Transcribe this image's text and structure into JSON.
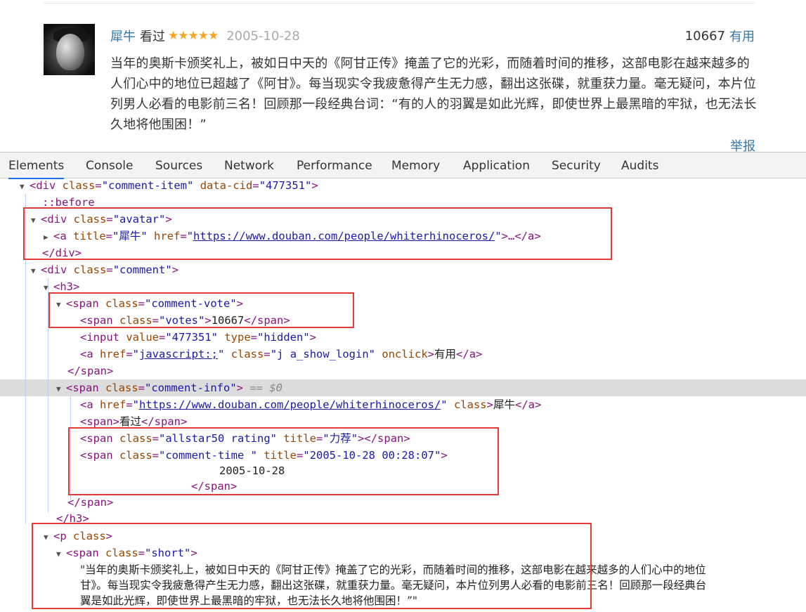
{
  "page": {
    "user": "犀牛",
    "watched": "看过",
    "stars": "★★★★★",
    "time": "2005-10-28",
    "votes": "10667",
    "useful": "有用",
    "short": "当年的奥斯卡颁奖礼上，被如日中天的《阿甘正传》掩盖了它的光彩，而随着时间的推移，这部电影在越来越多的人们心中的地位已超越了《阿甘》。每当现实令我疲惫得产生无力感，翻出这张碟，就重获力量。毫无疑问，本片位列男人必看的电影前三名！回顾那一段经典台词：“有的人的羽翼是如此光辉，即使世界上最黑暗的牢狱，也无法长久地将他围困！”",
    "report": "举报"
  },
  "devtools": {
    "tabs": [
      "Elements",
      "Console",
      "Sources",
      "Network",
      "Performance",
      "Memory",
      "Application",
      "Security",
      "Audits"
    ],
    "tree": {
      "l1_tag_open": "<div ",
      "l1_attr1": "class",
      "l1_val1": "\"comment-item\"",
      "l1_attr2": "data-cid",
      "l1_val2": "\"477351\"",
      "l1_tag_close": ">",
      "l2": "::before",
      "l3_tag_open": "<div ",
      "l3_attr": "class",
      "l3_val": "\"avatar\"",
      "l3_tag_close": ">",
      "l4_tag_open": "<a ",
      "l4_attr1": "title",
      "l4_val1": "\"犀牛\"",
      "l4_attr2": "href",
      "l4_q1": "\"",
      "l4_link": "https://www.douban.com/people/whiterhinoceros/",
      "l4_q2": "\"",
      "l4_tag_close": ">…</a>",
      "l5": "</div>",
      "l6_tag_open": "<div ",
      "l6_attr": "class",
      "l6_val": "\"comment\"",
      "l6_tag_close": ">",
      "l7": "<h3>",
      "l8_tag_open": "<span ",
      "l8_attr": "class",
      "l8_val": "\"comment-vote\"",
      "l8_tag_close": ">",
      "l9_tag_open": "<span ",
      "l9_attr": "class",
      "l9_val": "\"votes\"",
      "l9_gt": ">",
      "l9_text": "10667",
      "l9_close": "</span>",
      "l10_tag_open": "<input ",
      "l10_attr1": "value",
      "l10_val1": "\"477351\"",
      "l10_attr2": "type",
      "l10_val2": "\"hidden\"",
      "l10_tag_close": ">",
      "l11_tag_open": "<a ",
      "l11_attr1": "href",
      "l11_q1": "\"",
      "l11_link": "javascript:;",
      "l11_q2": "\"",
      "l11_attr2": "class",
      "l11_val2": "\"j a_show_login\"",
      "l11_attr3": "onclick",
      "l11_gt": ">",
      "l11_text": "有用",
      "l11_close": "</a>",
      "l12": "</span>",
      "l13_tag_open": "<span ",
      "l13_attr": "class",
      "l13_val": "\"comment-info\"",
      "l13_tag_close": ">",
      "l13_eq": " == $0",
      "l14_tag_open": "<a ",
      "l14_attr1": "href",
      "l14_q1": "\"",
      "l14_link": "https://www.douban.com/people/whiterhinoceros/",
      "l14_q2": "\"",
      "l14_attr2": "class",
      "l14_gt": ">",
      "l14_text": "犀牛",
      "l14_close": "</a>",
      "l15_open": "<span>",
      "l15_text": "看过",
      "l15_close": "</span>",
      "l16_tag_open": "<span ",
      "l16_attr1": "class",
      "l16_val1": "\"allstar50 rating\"",
      "l16_attr2": "title",
      "l16_val2": "\"力荐\"",
      "l16_tag_close": "></span>",
      "l17_tag_open": "<span ",
      "l17_attr1": "class",
      "l17_val1": "\"comment-time \"",
      "l17_attr2": "title",
      "l17_val2": "\"2005-10-28 00:28:07\"",
      "l17_tag_close": ">",
      "l18": "2005-10-28",
      "l19": "</span>",
      "l20": "</span>",
      "l21": "</h3>",
      "l22_tag_open": "<p ",
      "l22_attr": "class",
      "l22_tag_close": ">",
      "l23_tag_open": "<span ",
      "l23_attr": "class",
      "l23_val": "\"short\"",
      "l23_tag_close": ">",
      "l24": "\"当年的奥斯卡颁奖礼上，被如日中天的《阿甘正传》掩盖了它的光彩，而随着时间的推移，这部电影在越来越多的人们心中的地位",
      "l25": "甘》。每当现实令我疲惫得产生无力感，翻出这张碟，就重获力量。毫无疑问，本片位列男人必看的电影前三名！回顾那一段经典台",
      "l26": "翼是如此光辉，即使世界上最黑暗的牢狱，也无法长久地将他围困！”\""
    }
  }
}
